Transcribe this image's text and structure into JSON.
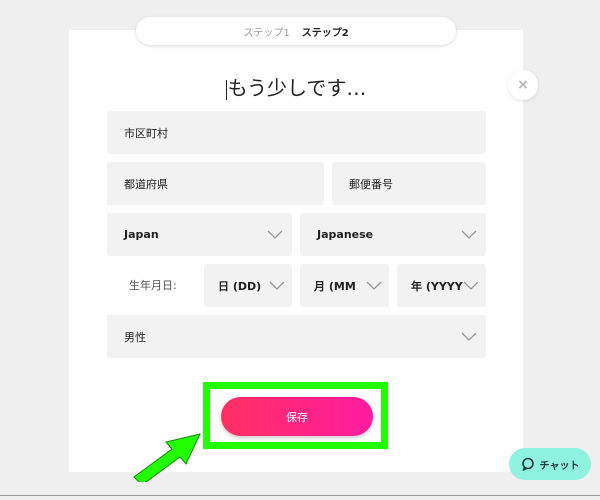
{
  "steps": {
    "step1": "ステップ1",
    "step2": "ステップ2"
  },
  "close": {
    "glyph": "×"
  },
  "title": "もう少しです…",
  "fields": {
    "city_placeholder": "市区町村",
    "prefecture_placeholder": "都道府県",
    "postal_placeholder": "郵便番号"
  },
  "selects": {
    "country": "Japan",
    "language": "Japanese",
    "gender": "男性"
  },
  "dob": {
    "label": "生年月日:",
    "day_prefix": "日",
    "day_hint": "(DD)",
    "month_prefix": "月",
    "month_hint": "(MM",
    "year_prefix": "年",
    "year_hint": "(YYYY)"
  },
  "save_label": "保存",
  "chat_label": "チャット",
  "colors": {
    "highlight": "#22ff00",
    "save_gradient_start": "#ff2f62",
    "save_gradient_end": "#ff1ba0",
    "chat_bg": "#8ef2df"
  }
}
